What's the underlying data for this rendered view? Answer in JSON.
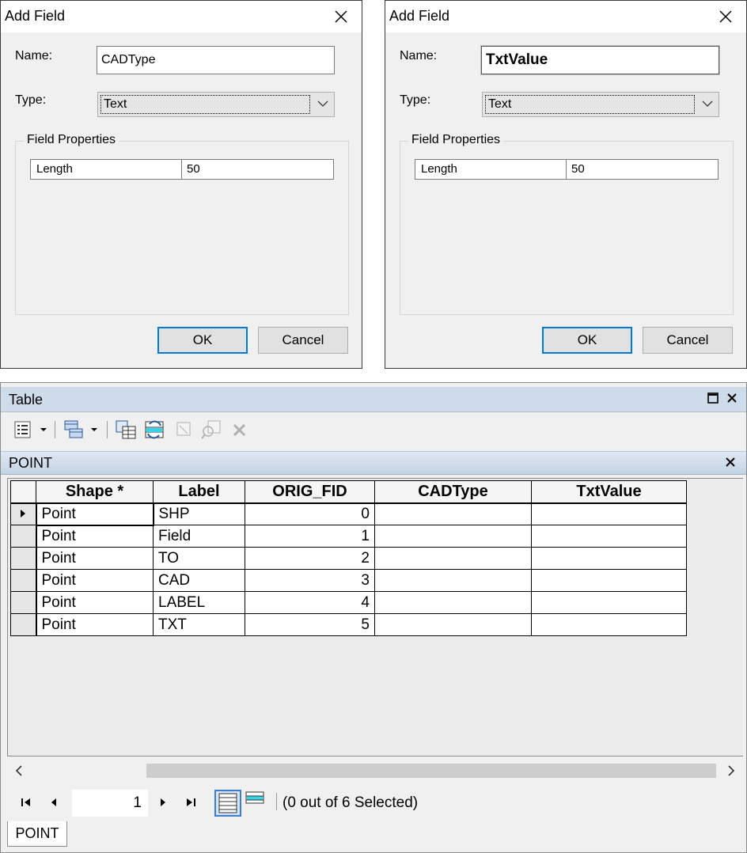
{
  "dialogs": [
    {
      "title": "Add Field",
      "name_label": "Name:",
      "name_value": "CADType",
      "type_label": "Type:",
      "type_value": "Text",
      "group_caption": "Field Properties",
      "prop_key": "Length",
      "prop_value": "50",
      "ok_label": "OK",
      "cancel_label": "Cancel"
    },
    {
      "title": "Add Field",
      "name_label": "Name:",
      "name_value": "TxtValue",
      "type_label": "Type:",
      "type_value": "Text",
      "group_caption": "Field Properties",
      "prop_key": "Length",
      "prop_value": "50",
      "ok_label": "OK",
      "cancel_label": "Cancel"
    }
  ],
  "table_window": {
    "title": "Table",
    "tab_label": "POINT",
    "columns": [
      "Shape *",
      "Label",
      "ORIG_FID",
      "CADType",
      "TxtValue"
    ],
    "rows": [
      {
        "shape": "Point",
        "label": "SHP",
        "orig_fid": "0",
        "cadtype": "",
        "txtvalue": ""
      },
      {
        "shape": "Point",
        "label": "Field",
        "orig_fid": "1",
        "cadtype": "",
        "txtvalue": ""
      },
      {
        "shape": "Point",
        "label": "TO",
        "orig_fid": "2",
        "cadtype": "",
        "txtvalue": ""
      },
      {
        "shape": "Point",
        "label": "CAD",
        "orig_fid": "3",
        "cadtype": "",
        "txtvalue": ""
      },
      {
        "shape": "Point",
        "label": "LABEL",
        "orig_fid": "4",
        "cadtype": "",
        "txtvalue": ""
      },
      {
        "shape": "Point",
        "label": "TXT",
        "orig_fid": "5",
        "cadtype": "",
        "txtvalue": ""
      }
    ],
    "current_record": "1",
    "selection_status": "(0 out of 6 Selected)",
    "sheet_tab": "POINT"
  },
  "colors": {
    "accent": "#0078d7",
    "title_bar": "#cedbea",
    "dialog_bg": "#f0f0f0"
  },
  "icons": [
    "close-icon",
    "chevron-down-icon",
    "table-options-icon",
    "related-tables-icon",
    "select-by-attributes-icon",
    "switch-selection-icon",
    "clear-selection-icon",
    "zoom-to-selected-icon",
    "delete-selected-icon",
    "maximize-icon",
    "first-record-icon",
    "previous-record-icon",
    "next-record-icon",
    "last-record-icon",
    "show-all-records-icon",
    "show-selected-records-icon"
  ]
}
